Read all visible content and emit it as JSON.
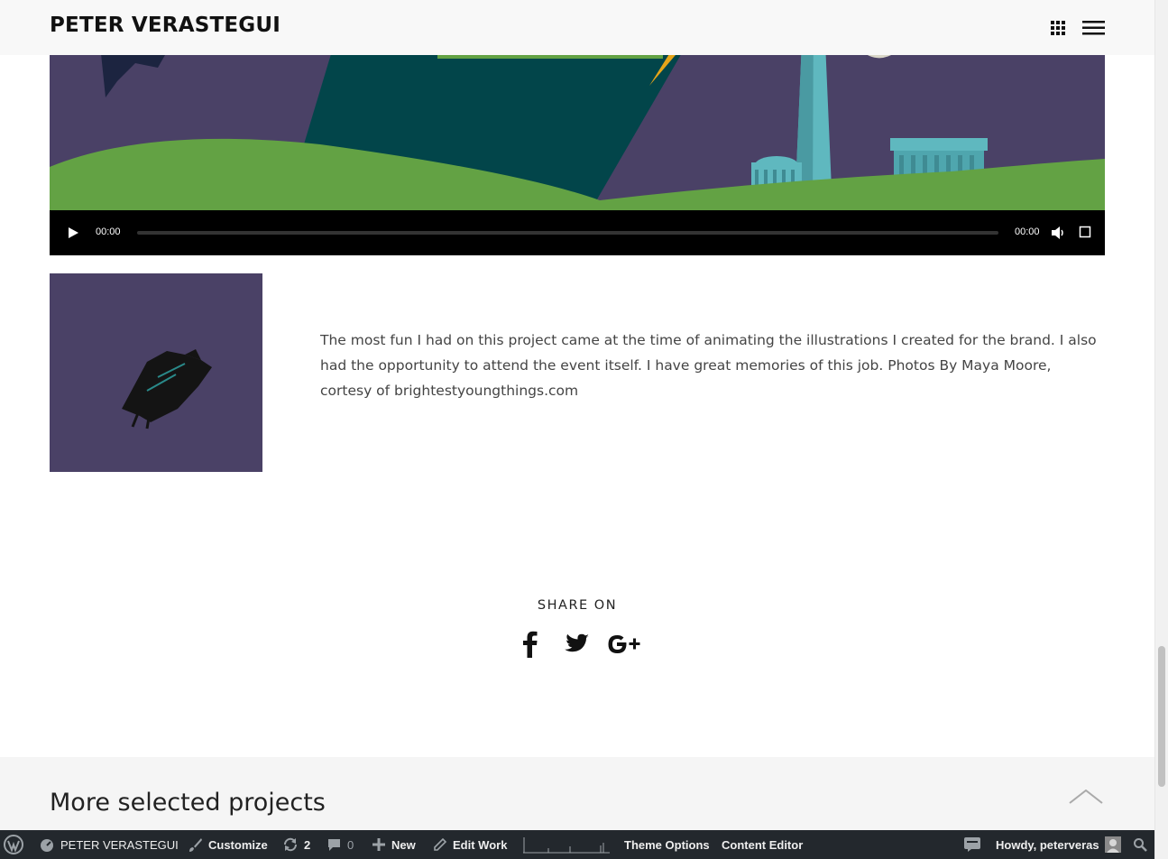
{
  "header": {
    "logo": "PETER VERASTEGUI",
    "grid_icon": "grid-icon",
    "menu_icon": "hamburger-menu-icon"
  },
  "video": {
    "current_time": "00:00",
    "duration": "00:00",
    "progress": 0,
    "colors": {
      "sky": "#4a4166",
      "hill": "#63a244",
      "teal": "#02454a",
      "monument": "#5fb8bf"
    }
  },
  "description": {
    "text": "The most fun I had on this project came at the time of animating the illustrations I created for the brand. I also had the opportunity to attend the event itself. I have great memories of this job. Photos By Maya Moore, cortesy of brightestyoungthings.com"
  },
  "share": {
    "title": "SHARE ON",
    "networks": [
      "facebook-icon",
      "twitter-icon",
      "google-plus-icon"
    ]
  },
  "more_projects": {
    "title": "More selected projects"
  },
  "adminbar": {
    "site_name": "PETER VERASTEGUI",
    "customize": "Customize",
    "updates_count": "2",
    "comments_count": "0",
    "new": "New",
    "edit_work": "Edit Work",
    "theme_options": "Theme Options",
    "content_editor": "Content Editor",
    "howdy": "Howdy, peterveras"
  }
}
